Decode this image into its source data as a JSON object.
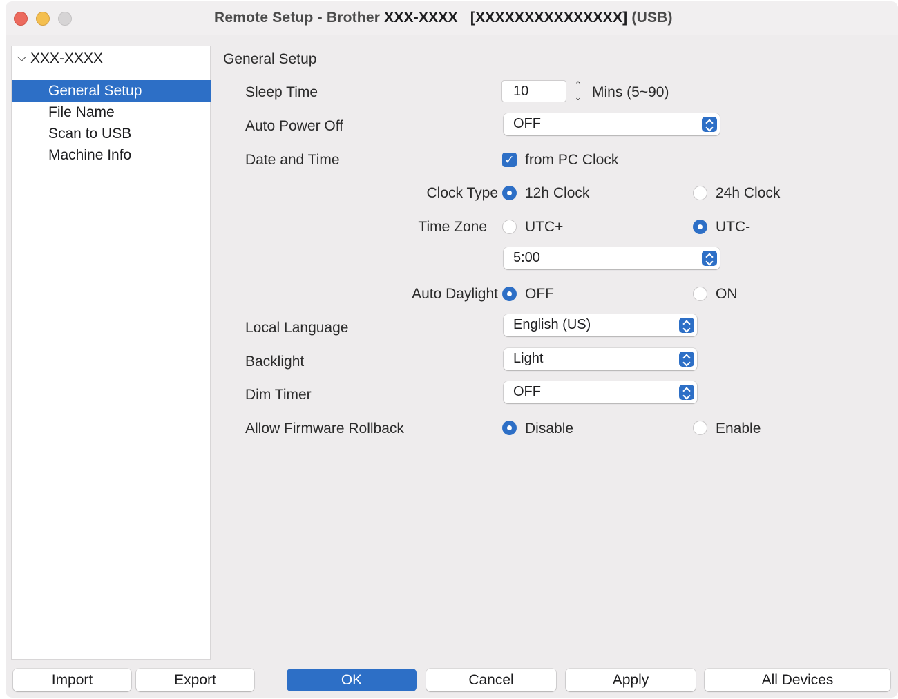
{
  "window": {
    "title_prefix": "Remote Setup - Brother ",
    "title_model": "XXX-XXXX",
    "title_serial": "   [XXXXXXXXXXXXXXX]",
    "title_suffix": " (USB)"
  },
  "sidebar": {
    "root": "XXX-XXXX",
    "items": [
      {
        "label": "General Setup",
        "selected": true
      },
      {
        "label": "File Name",
        "selected": false
      },
      {
        "label": "Scan to USB",
        "selected": false
      },
      {
        "label": "Machine Info",
        "selected": false
      }
    ]
  },
  "main": {
    "section_title": "General Setup",
    "sleep_time": {
      "label": "Sleep Time",
      "value": "10",
      "unit": "Mins (5~90)"
    },
    "auto_power_off": {
      "label": "Auto Power Off",
      "value": "OFF"
    },
    "date_and_time": {
      "label": "Date and Time",
      "checkbox_label": "from PC Clock",
      "checked": true
    },
    "clock_type": {
      "label": "Clock Type",
      "option1": "12h Clock",
      "option2": "24h Clock",
      "selected": "12h Clock"
    },
    "time_zone": {
      "label": "Time Zone",
      "option1": "UTC+",
      "option2": "UTC-",
      "selected": "UTC-",
      "offset": "5:00"
    },
    "auto_daylight": {
      "label": "Auto Daylight",
      "option1": "OFF",
      "option2": "ON",
      "selected": "OFF"
    },
    "local_language": {
      "label": "Local Language",
      "value": "English (US)"
    },
    "backlight": {
      "label": "Backlight",
      "value": "Light"
    },
    "dim_timer": {
      "label": "Dim Timer",
      "value": "OFF"
    },
    "firmware_rollback": {
      "label": "Allow Firmware Rollback",
      "option1": "Disable",
      "option2": "Enable",
      "selected": "Disable"
    }
  },
  "buttons": {
    "import": "Import",
    "export": "Export",
    "ok": "OK",
    "cancel": "Cancel",
    "apply": "Apply",
    "all_devices": "All Devices"
  },
  "colors": {
    "accent": "#2d6fc6",
    "close": "#ec6a5e",
    "minimize": "#f4bf4f",
    "zoom_inactive": "#d6d4d5"
  },
  "icons": {
    "close": "close-traffic-light",
    "minimize": "minimize-traffic-light",
    "zoom": "zoom-traffic-light",
    "tree_expand": "chevron-down-icon",
    "stepper": "stepper-arrows-icon",
    "popup": "popup-arrows-icon",
    "checkbox": "checkmark-icon"
  }
}
